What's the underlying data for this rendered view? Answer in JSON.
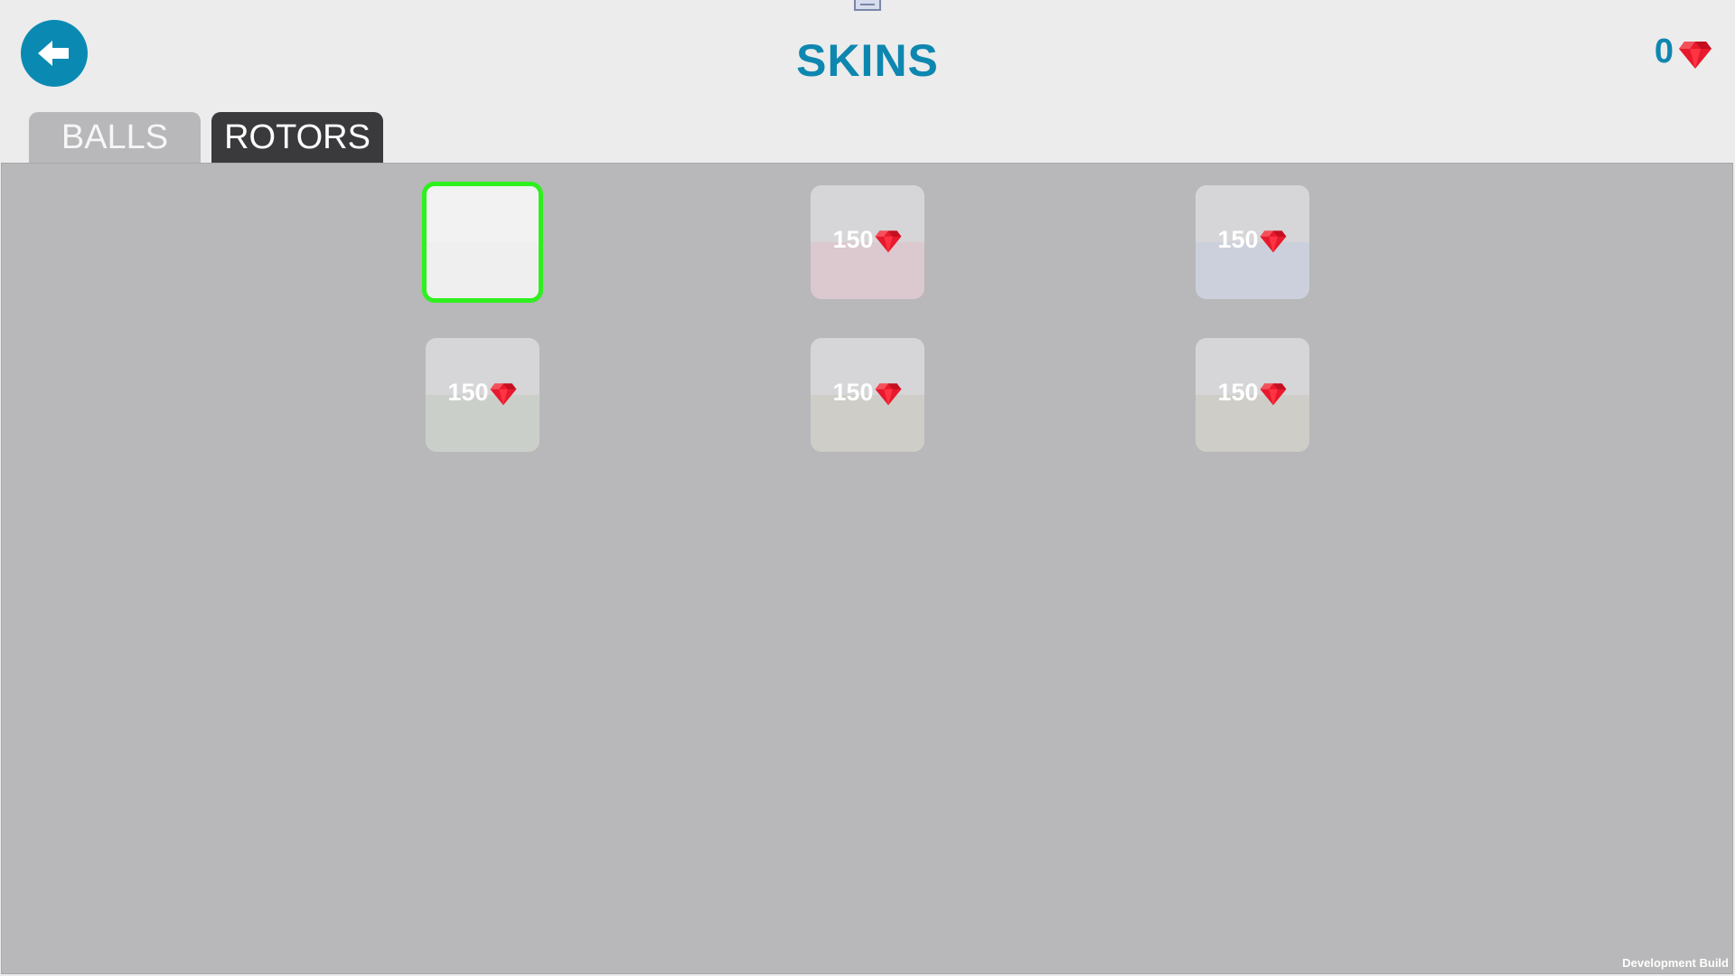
{
  "header": {
    "title": "SKINS",
    "balance": "0",
    "accent_color": "#0e87b0"
  },
  "tabs": [
    {
      "label": "BALLS",
      "active": false
    },
    {
      "label": "ROTORS",
      "active": true
    }
  ],
  "items": [
    {
      "price": "",
      "selected": true,
      "tint": "#efefef"
    },
    {
      "price": "150",
      "selected": false,
      "tint": "#dcc8cf"
    },
    {
      "price": "150",
      "selected": false,
      "tint": "#cbd0dc"
    },
    {
      "price": "150",
      "selected": false,
      "tint": "#cbcfca"
    },
    {
      "price": "150",
      "selected": false,
      "tint": "#cecdc8"
    },
    {
      "price": "150",
      "selected": false,
      "tint": "#cecdc8"
    }
  ],
  "footer": {
    "build_label": "Development Build"
  }
}
